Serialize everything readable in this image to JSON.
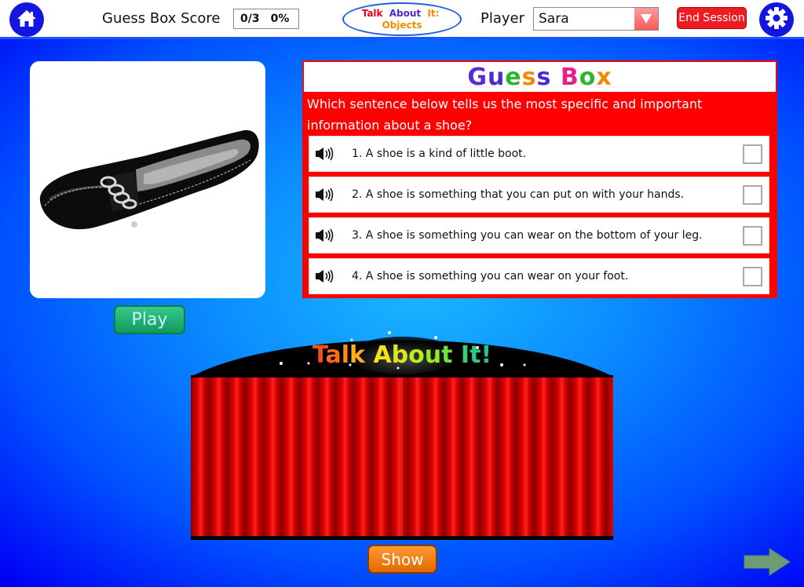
{
  "topbar": {
    "home_icon": "home-icon",
    "score_label": "Guess Box Score",
    "score_fraction": "0/3",
    "score_percent": "0%",
    "logo": {
      "line1_words": [
        "Talk",
        "About",
        "It:"
      ],
      "line2": "Objects",
      "line1_colors": [
        "#e8001c",
        "#4a2bd0",
        "#f08c00"
      ],
      "line2_color": "#f08c00"
    },
    "player_label": "Player",
    "player_value": "Sara",
    "end_session_label": "End Session",
    "settings_icon": "gear-icon"
  },
  "image_card": {
    "subject": "black loafer shoe with silver chain",
    "play_label": "Play"
  },
  "guess_box": {
    "title_letters": [
      {
        "ch": "G",
        "color": "#5a2bd0"
      },
      {
        "ch": "u",
        "color": "#4b2bd0"
      },
      {
        "ch": "e",
        "color": "#2bb530"
      },
      {
        "ch": "s",
        "color": "#f08c00"
      },
      {
        "ch": "s",
        "color": "#4a2bd0"
      },
      {
        "ch": " ",
        "color": "#000"
      },
      {
        "ch": "B",
        "color": "#e81e8c"
      },
      {
        "ch": "o",
        "color": "#2bb530"
      },
      {
        "ch": "x",
        "color": "#f08c00"
      }
    ],
    "question": "Which sentence below tells us the most specific and important information about a shoe?",
    "options": [
      {
        "text": "1. A shoe is a kind of little boot.",
        "checked": false
      },
      {
        "text": "2. A shoe is something that you can put on with your hands.",
        "checked": false
      },
      {
        "text": "3. A shoe is something you can wear on the bottom of your leg.",
        "checked": false
      },
      {
        "text": "4. A shoe is something you can wear on your foot.",
        "checked": false
      }
    ]
  },
  "stage": {
    "banner_title": "Talk About It!",
    "show_label": "Show"
  },
  "colors": {
    "accent_blue": "#1515e0",
    "guess_red": "#ff0000",
    "end_session_red": "#ee1b22",
    "play_green": "#139a5e",
    "show_orange": "#e06a00",
    "next_arrow": "#6f9a78"
  }
}
